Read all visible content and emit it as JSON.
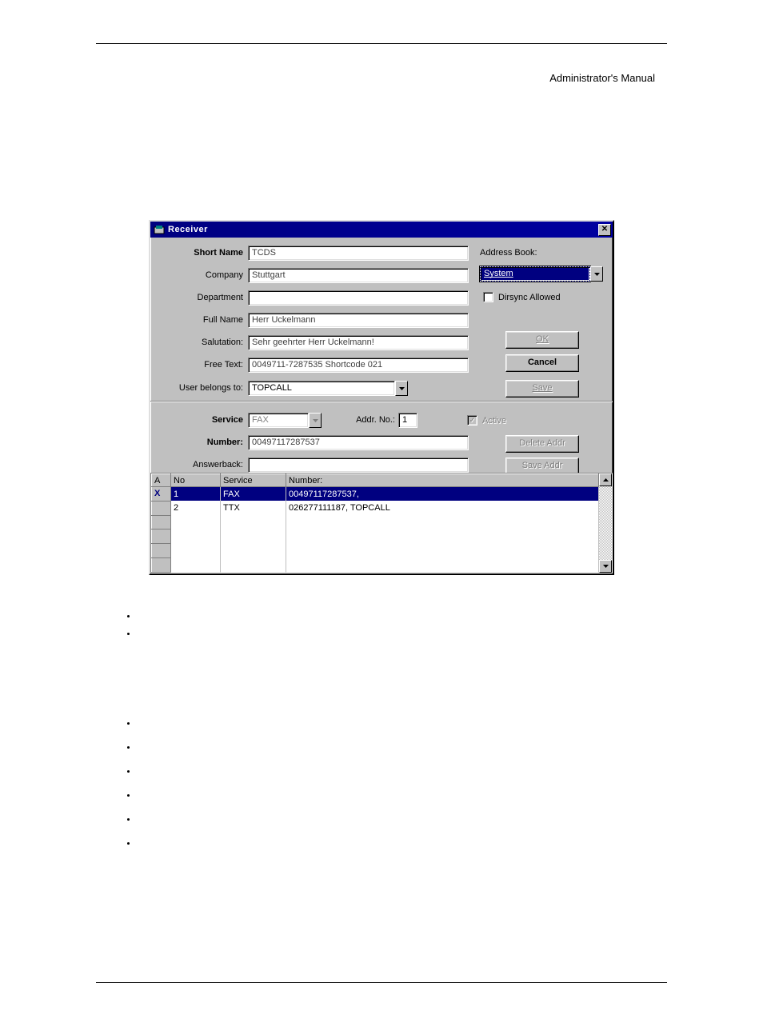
{
  "page_header": "Administrator's Manual",
  "dialog": {
    "title": "Receiver",
    "labels": {
      "short_name": "Short Name",
      "company": "Company",
      "department": "Department",
      "full_name": "Full Name",
      "salutation": "Salutation:",
      "free_text": "Free Text:",
      "user_belongs_to": "User belongs to:",
      "address_book": "Address Book:",
      "dirsync": "Dirsync Allowed",
      "service": "Service",
      "addr_no": "Addr. No.:",
      "number": "Number:",
      "answerback": "Answerback:",
      "active": "Active"
    },
    "values": {
      "short_name": "TCDS",
      "company": "Stuttgart",
      "department": "",
      "full_name": "Herr Uckelmann",
      "salutation": "Sehr geehrter Herr Uckelmann!",
      "free_text": "0049711-7287535    Shortcode 021",
      "user_belongs_to": "TOPCALL",
      "address_book": "System",
      "service": "FAX",
      "addr_no": "1",
      "number": "00497117287537",
      "answerback": "",
      "dirsync_checked": false,
      "active_checked": true
    },
    "buttons": {
      "ok": "OK",
      "cancel": "Cancel",
      "save": "Save",
      "delete_addr": "Delete Addr",
      "save_addr": "Save Addr"
    },
    "table": {
      "headers": {
        "a": "A",
        "no": "No",
        "service": "Service",
        "number": "Number:"
      },
      "rows": [
        {
          "a": "X",
          "no": "1",
          "service": "FAX",
          "number": "00497117287537,"
        },
        {
          "a": "",
          "no": "2",
          "service": "TTX",
          "number": "026277111187, TOPCALL"
        }
      ]
    }
  }
}
